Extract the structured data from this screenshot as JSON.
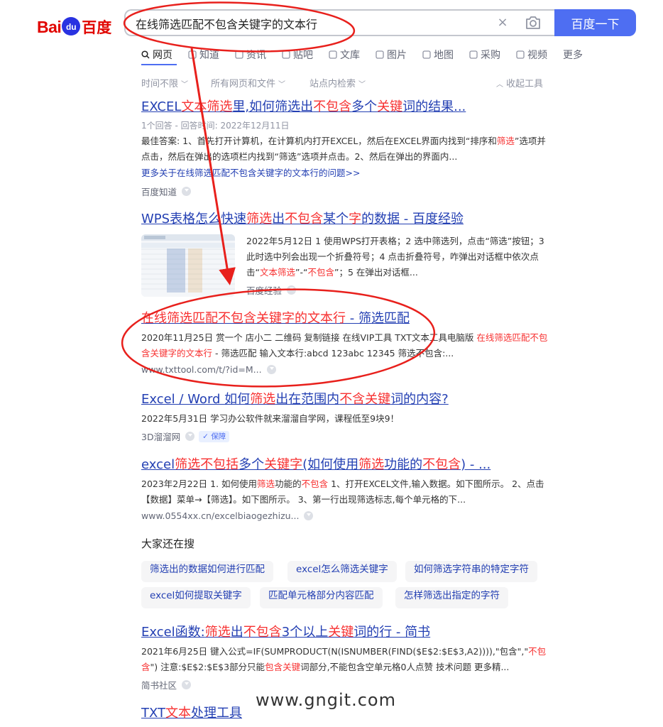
{
  "logo": {
    "part1": "Bai",
    "paw": "du",
    "part2": "百度"
  },
  "search": {
    "query": "在线筛选匹配不包含关键字的文本行",
    "clear_icon": "×",
    "button_label": "百度一下"
  },
  "tabs": [
    {
      "label": "网页",
      "icon": "search-icon",
      "active": true
    },
    {
      "label": "知道",
      "icon": "question-icon"
    },
    {
      "label": "资讯",
      "icon": "news-icon"
    },
    {
      "label": "贴吧",
      "icon": "tieba-icon"
    },
    {
      "label": "文库",
      "icon": "document-icon"
    },
    {
      "label": "图片",
      "icon": "image-icon"
    },
    {
      "label": "地图",
      "icon": "map-pin-icon"
    },
    {
      "label": "采购",
      "icon": "shopping-icon"
    },
    {
      "label": "视频",
      "icon": "video-icon"
    },
    {
      "label": "更多",
      "icon": ""
    }
  ],
  "tools": {
    "time": "时间不限",
    "filetype": "所有网页和文件",
    "site": "站点内检索",
    "collapse": "收起工具"
  },
  "results": [
    {
      "title_parts": [
        {
          "t": "EXCEL",
          "em": false
        },
        {
          "t": "文本筛选",
          "em": true
        },
        {
          "t": "里,如何筛选出",
          "em": false
        },
        {
          "t": "不包含",
          "em": true
        },
        {
          "t": "多个",
          "em": false
        },
        {
          "t": "关键",
          "em": true
        },
        {
          "t": "词的",
          "em": false
        },
        {
          "t": "结果...",
          "em": false
        }
      ],
      "meta": "1个回答 - 回答时间: 2022年12月11日",
      "abstract_parts": [
        {
          "t": "最佳答案: 1、首先打开计算机，在计算机内打开EXCEL，然后在EXCEL界面内找到“排序和",
          "em": false
        },
        {
          "t": "筛选",
          "em": true
        },
        {
          "t": "”选项并点击，然后在弹出的选项栏内找到“筛选”选项并点击。2、然后在弹出的界面内...",
          "em": false
        }
      ],
      "more_link": "更多关于在线筛选匹配不包含关键字的文本行的问题>>",
      "source": "百度知道"
    },
    {
      "title_parts": [
        {
          "t": "WPS表格怎么快速",
          "em": false
        },
        {
          "t": "筛选",
          "em": true
        },
        {
          "t": "出",
          "em": false
        },
        {
          "t": "不包含",
          "em": true
        },
        {
          "t": "某个",
          "em": false
        },
        {
          "t": "字",
          "em": true
        },
        {
          "t": "的数据 - 百度经验",
          "em": false
        }
      ],
      "abstract_parts": [
        {
          "t": "2022年5月12日 1 使用WPS打开表格；2 选中筛选列，点击“筛选”按钮；3 此时选中列会出现一个折叠符号；4 点击折叠符号，咋弹出对话框中依次点击“",
          "em": false
        },
        {
          "t": "文本筛选",
          "em": true
        },
        {
          "t": "”-“",
          "em": false
        },
        {
          "t": "不包含",
          "em": true
        },
        {
          "t": "”；5 在弹出对话框...",
          "em": false
        }
      ],
      "source": "百度经验"
    },
    {
      "title_parts": [
        {
          "t": "在线筛选匹配不包含关键字的文本行",
          "em": true
        },
        {
          "t": " - 筛选匹配",
          "em": false
        }
      ],
      "abstract_parts": [
        {
          "t": "2020年11月25日 赏一个 店小二 二维码 复制链接 在线VIP工具 TXT文本工具电脑版 ",
          "em": false
        },
        {
          "t": "在线筛选匹配不包含关键字的文本行",
          "em": true
        },
        {
          "t": " - 筛选匹配 输入文本行:abcd 123abc 12345 筛选不包含:...",
          "em": false
        }
      ],
      "source": "www.txttool.com/t/?id=M..."
    },
    {
      "title_parts": [
        {
          "t": "Excel / Word 如何",
          "em": false
        },
        {
          "t": "筛选",
          "em": true
        },
        {
          "t": "出在范围内",
          "em": false
        },
        {
          "t": "不含关键",
          "em": true
        },
        {
          "t": "词的内容?",
          "em": false
        }
      ],
      "abstract_parts": [
        {
          "t": "2022年5月31日 学习办公软件就来溜溜自学网，课程低至9块9！",
          "em": false
        }
      ],
      "source": "3D溜溜网",
      "badge": "保障"
    },
    {
      "title_parts": [
        {
          "t": "excel",
          "em": false
        },
        {
          "t": "筛选不包括",
          "em": true
        },
        {
          "t": "多个",
          "em": false
        },
        {
          "t": "关键字",
          "em": true
        },
        {
          "t": "(如何使用",
          "em": false
        },
        {
          "t": "筛选",
          "em": true
        },
        {
          "t": "功能的",
          "em": false
        },
        {
          "t": "不包含",
          "em": true
        },
        {
          "t": ") - ...",
          "em": false
        }
      ],
      "abstract_parts": [
        {
          "t": "2023年2月22日 1. 如何使用",
          "em": false
        },
        {
          "t": "筛选",
          "em": true
        },
        {
          "t": "功能的",
          "em": false
        },
        {
          "t": "不包含",
          "em": true
        },
        {
          "t": " 1、打开EXCEL文件,输入数据。如下图所示。 2、点击【数据】菜单→【筛选】。如下图所示。 3、第一行出现筛选标志,每个单元格的下...",
          "em": false
        }
      ],
      "source": "www.0554xx.cn/excelbiaogezhizu..."
    },
    {
      "title_parts": [
        {
          "t": "Excel函数:",
          "em": false
        },
        {
          "t": "筛选",
          "em": true
        },
        {
          "t": "出",
          "em": false
        },
        {
          "t": "不包含",
          "em": true
        },
        {
          "t": "3个以上",
          "em": false
        },
        {
          "t": "关键",
          "em": true
        },
        {
          "t": "词的行 - 简书",
          "em": false
        }
      ],
      "abstract_parts": [
        {
          "t": "2021年6月25日 键入公式=IF(SUMPRODUCT(N(ISNUMBER(FIND($E$2:$E$3,A2)))),\"包含\",\"",
          "em": false
        },
        {
          "t": "不包含",
          "em": true
        },
        {
          "t": "\") 注意:$E$2:$E$3部分只能",
          "em": false
        },
        {
          "t": "包含关键",
          "em": true
        },
        {
          "t": "词部分,不能包含空单元格0人点赞 技术问题 更多精...",
          "em": false
        }
      ],
      "source": "简书社区"
    },
    {
      "title_parts": [
        {
          "t": "TXT",
          "em": false
        },
        {
          "t": "文本",
          "em": true
        },
        {
          "t": "处理工具",
          "em": false
        }
      ]
    }
  ],
  "related": {
    "heading": "大家还在搜",
    "items": [
      "筛选出的数据如何进行匹配",
      "excel怎么筛选关键字",
      "如何筛选字符串的特定字符",
      "excel如何提取关键字",
      "匹配单元格部分内容匹配",
      "怎样筛选出指定的字符"
    ]
  },
  "watermark": "www.gngit.com",
  "colors": {
    "brand_blue": "#4e6ef2",
    "title_blue": "#2440b3",
    "highlight_red": "#f73131",
    "annotation_red": "#e8201c"
  }
}
